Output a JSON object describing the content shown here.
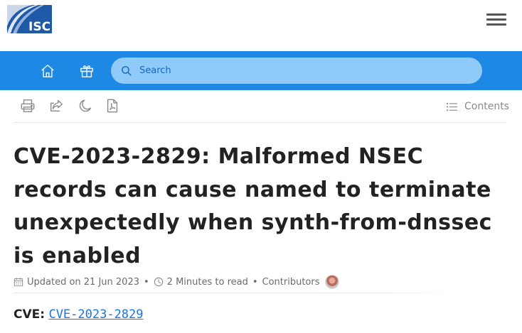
{
  "header": {
    "logo_text": "ISC",
    "colors": {
      "logo_blue": "#1e5aa8",
      "nav_blue": "#1e88e5",
      "search_bg": "#90caf9"
    }
  },
  "nav": {
    "icons": [
      "home-icon",
      "gift-icon"
    ],
    "search": {
      "placeholder": "Search",
      "value": ""
    }
  },
  "toolbar": {
    "icons": [
      "print-icon",
      "share-icon",
      "moon-icon",
      "pdf-icon"
    ],
    "contents_label": "Contents"
  },
  "article": {
    "title": "CVE-2023-2829: Malformed NSEC records can cause named to terminate unexpectedly when synth-from-dnssec is enabled",
    "meta": {
      "updated": "Updated on 21 Jun 2023",
      "read_time": "2 Minutes to read",
      "contributors_label": "Contributors"
    },
    "cve_label": "CVE:",
    "cve_link": "CVE-2023-2829"
  }
}
